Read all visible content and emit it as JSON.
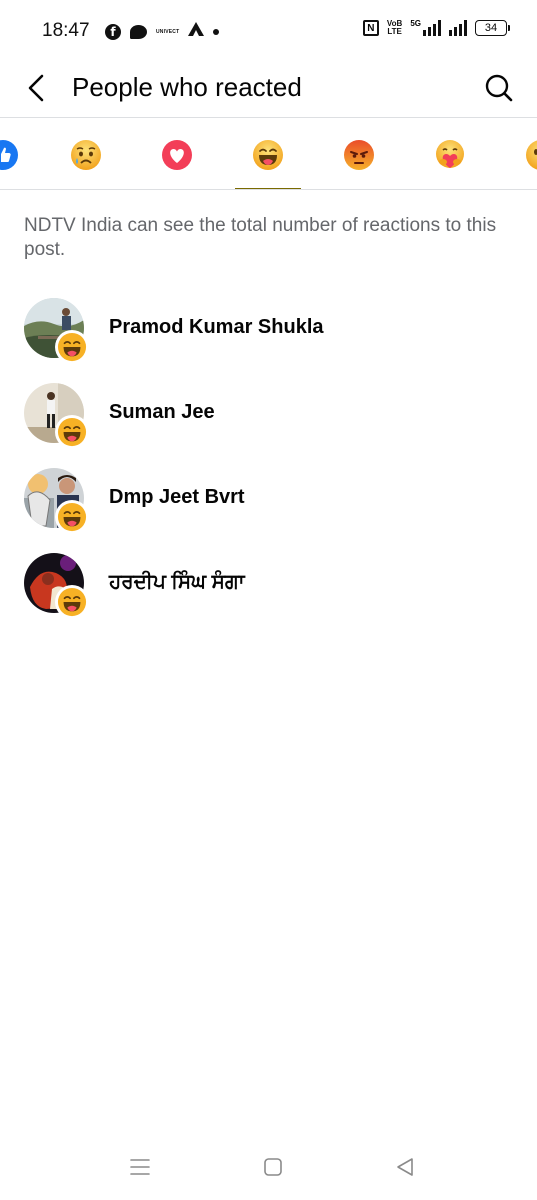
{
  "status_bar": {
    "time": "18:47",
    "tiny_app_label": "UNIVECT",
    "nfc_label": "N",
    "volte_top": "VoB",
    "volte_bottom": "LTE",
    "network": "5G",
    "battery": "34"
  },
  "header": {
    "title": "People who reacted",
    "back_icon": "chevron-left-icon",
    "search_icon": "search-icon"
  },
  "reaction_tabs": [
    {
      "name": "like",
      "active": false
    },
    {
      "name": "sad",
      "active": false
    },
    {
      "name": "love",
      "active": false
    },
    {
      "name": "haha",
      "active": true
    },
    {
      "name": "angry",
      "active": false
    },
    {
      "name": "care",
      "active": false
    },
    {
      "name": "wow",
      "active": false
    }
  ],
  "info_text": "NDTV India can see the total number of reactions to this post.",
  "reactors": [
    {
      "name": "Pramod Kumar Shukla",
      "reaction": "haha"
    },
    {
      "name": "Suman Jee",
      "reaction": "haha"
    },
    {
      "name": "Dmp Jeet Bvrt",
      "reaction": "haha"
    },
    {
      "name": "ਹਰਦੀਪ ਸਿੰਘ ਸੰਗਾ",
      "reaction": "haha"
    }
  ],
  "nav_bar": {
    "menu_icon": "menu-icon",
    "home_icon": "home-square-icon",
    "back_icon": "back-triangle-icon"
  },
  "colors": {
    "active_tab_underline": "#7a6a00",
    "secondary_text": "#65676b",
    "emoji_yellow": "#f7b125",
    "love_red": "#f33e58",
    "angry_red": "#e9710f"
  }
}
